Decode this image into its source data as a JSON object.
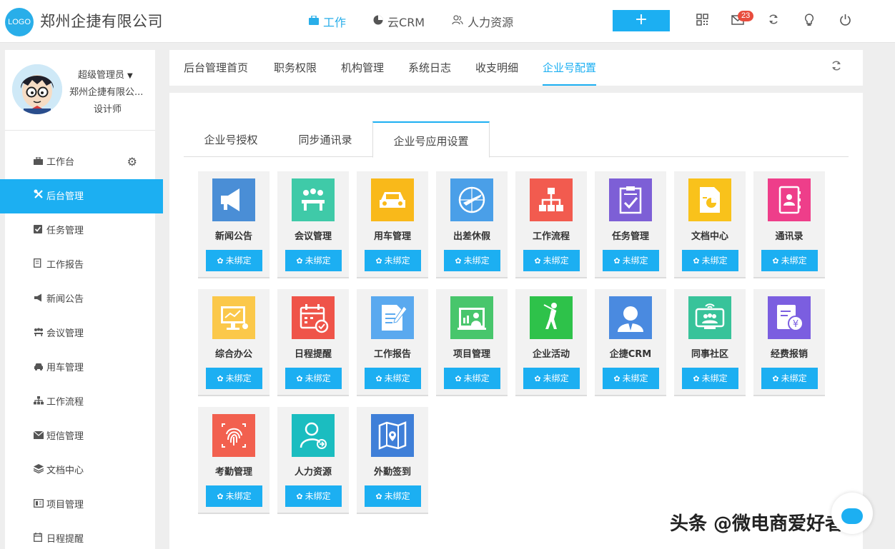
{
  "header": {
    "logo_text": "LOGO",
    "company": "郑州企捷有限公司",
    "nav": [
      {
        "label": "工作",
        "icon": "briefcase-icon",
        "active": true
      },
      {
        "label": "云CRM",
        "icon": "pie-chart-icon",
        "active": false
      },
      {
        "label": "人力资源",
        "icon": "users-icon",
        "active": false
      }
    ],
    "add_label": "+",
    "mail_badge": "23",
    "tools": [
      "qrcode-icon",
      "mail-icon",
      "refresh-icon",
      "lightbulb-icon",
      "power-icon"
    ]
  },
  "profile": {
    "role": "超级管理员",
    "company": "郑州企捷有限公...",
    "title": "设计师"
  },
  "sidebar": {
    "items": [
      {
        "label": "工作台",
        "icon": "toolbox-icon"
      },
      {
        "label": "后台管理",
        "icon": "tools-icon",
        "active": true
      },
      {
        "label": "任务管理",
        "icon": "checkbox-icon"
      },
      {
        "label": "工作报告",
        "icon": "edit-icon"
      },
      {
        "label": "新闻公告",
        "icon": "megaphone-icon"
      },
      {
        "label": "会议管理",
        "icon": "meeting-icon"
      },
      {
        "label": "用车管理",
        "icon": "car-icon"
      },
      {
        "label": "工作流程",
        "icon": "sitemap-icon"
      },
      {
        "label": "短信管理",
        "icon": "envelope-icon"
      },
      {
        "label": "文档中心",
        "icon": "layers-icon"
      },
      {
        "label": "项目管理",
        "icon": "project-icon"
      },
      {
        "label": "日程提醒",
        "icon": "calendar-icon"
      }
    ]
  },
  "tabs": [
    "后台管理首页",
    "职务权限",
    "机构管理",
    "系统日志",
    "收支明细",
    "企业号配置"
  ],
  "subtabs": [
    "企业号授权",
    "同步通讯录",
    "企业号应用设置"
  ],
  "bind_label": "未绑定",
  "apps": [
    {
      "name": "新闻公告",
      "color": "#4a8ed6",
      "icon": "megaphone-icon"
    },
    {
      "name": "会议管理",
      "color": "#3fcaa8",
      "icon": "meeting-icon"
    },
    {
      "name": "用车管理",
      "color": "#f9b91a",
      "icon": "car-icon"
    },
    {
      "name": "出差休假",
      "color": "#4a9fe8",
      "icon": "plane-icon"
    },
    {
      "name": "工作流程",
      "color": "#f25b4f",
      "icon": "sitemap-icon"
    },
    {
      "name": "任务管理",
      "color": "#7d5fd6",
      "icon": "clipboard-icon"
    },
    {
      "name": "文档中心",
      "color": "#f9c21b",
      "icon": "document-icon"
    },
    {
      "name": "通讯录",
      "color": "#ee3e8a",
      "icon": "contacts-icon"
    },
    {
      "name": "综合办公",
      "color": "#fbc84a",
      "icon": "office-icon"
    },
    {
      "name": "日程提醒",
      "color": "#ef5449",
      "icon": "calendar-icon"
    },
    {
      "name": "工作报告",
      "color": "#5aa9ef",
      "icon": "report-icon"
    },
    {
      "name": "项目管理",
      "color": "#48c66c",
      "icon": "project-icon"
    },
    {
      "name": "企业活动",
      "color": "#2ec24a",
      "icon": "golf-icon"
    },
    {
      "name": "企捷CRM",
      "color": "#4a8ae0",
      "icon": "person-icon"
    },
    {
      "name": "同事社区",
      "color": "#38c39a",
      "icon": "community-icon"
    },
    {
      "name": "经费报销",
      "color": "#7b5ee0",
      "icon": "money-icon"
    },
    {
      "name": "考勤管理",
      "color": "#f2604f",
      "icon": "fingerprint-icon"
    },
    {
      "name": "人力资源",
      "color": "#1bbdc0",
      "icon": "user-icon"
    },
    {
      "name": "外勤签到",
      "color": "#3f7fd8",
      "icon": "map-icon"
    }
  ],
  "watermark": "头条 @微电商爱好者"
}
